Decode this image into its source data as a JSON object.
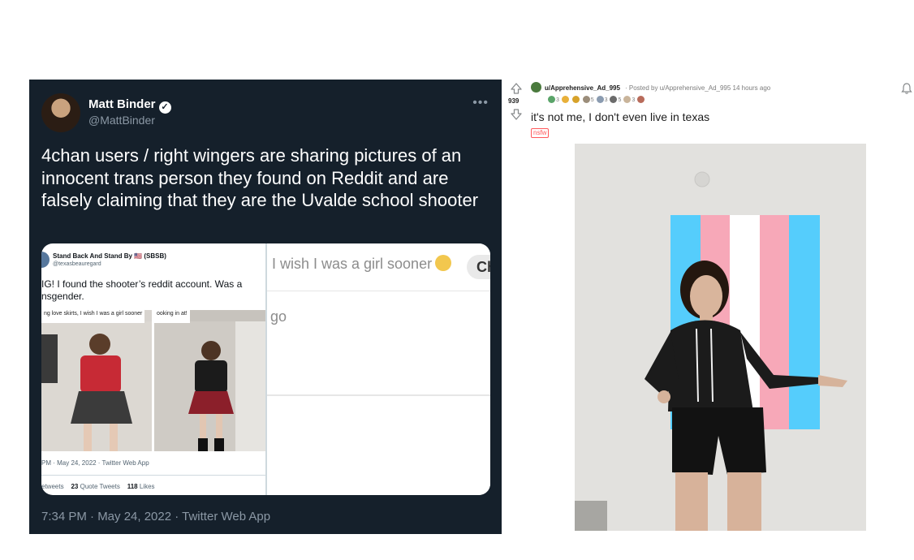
{
  "tweet": {
    "author_name": "Matt Binder",
    "verified_icon": "✓",
    "author_handle": "@MattBinder",
    "more_icon": "•••",
    "text": "4chan users / right wingers are sharing pictures of an innocent trans person they found on Reddit and are falsely claiming that they are the Uvalde school shooter",
    "timestamp": "7:34 PM · May 24, 2022 · Twitter Web App",
    "embed": {
      "author_name": "Stand Back And Stand By 🇺🇸 (SBSB)",
      "author_handle": "@texasbeauregard",
      "text": "IG! I found the shooter’s reddit account. Was a nsgender.",
      "photo1_caption": "ng love skirts, I wish I was a girl sooner",
      "photo2_caption": "ooking in at!",
      "meta": "PM · May 24, 2022 · Twitter Web App",
      "stats": {
        "retweets_label": "etweets",
        "quote_count": "23",
        "quote_label": "Quote Tweets",
        "likes_count": "118",
        "likes_label": "Likes"
      },
      "right_message": "I wish I was a girl sooner",
      "right_chip": "Ch",
      "right_fragment": "go"
    }
  },
  "reddit": {
    "vote_count": "939",
    "username": "u/Apprehensive_Ad_995",
    "posted_by": "· Posted by u/Apprehensive_Ad_995 14 hours ago",
    "award_counts": [
      "3",
      "5",
      "3",
      "5",
      "3"
    ],
    "title": "it's not me, I don't even live in texas",
    "nsfw_tag": "nsfw",
    "colors": {
      "upvote": "#878a8c",
      "nsfw": "#ff585b",
      "twitter_bg": "#15202b"
    }
  }
}
